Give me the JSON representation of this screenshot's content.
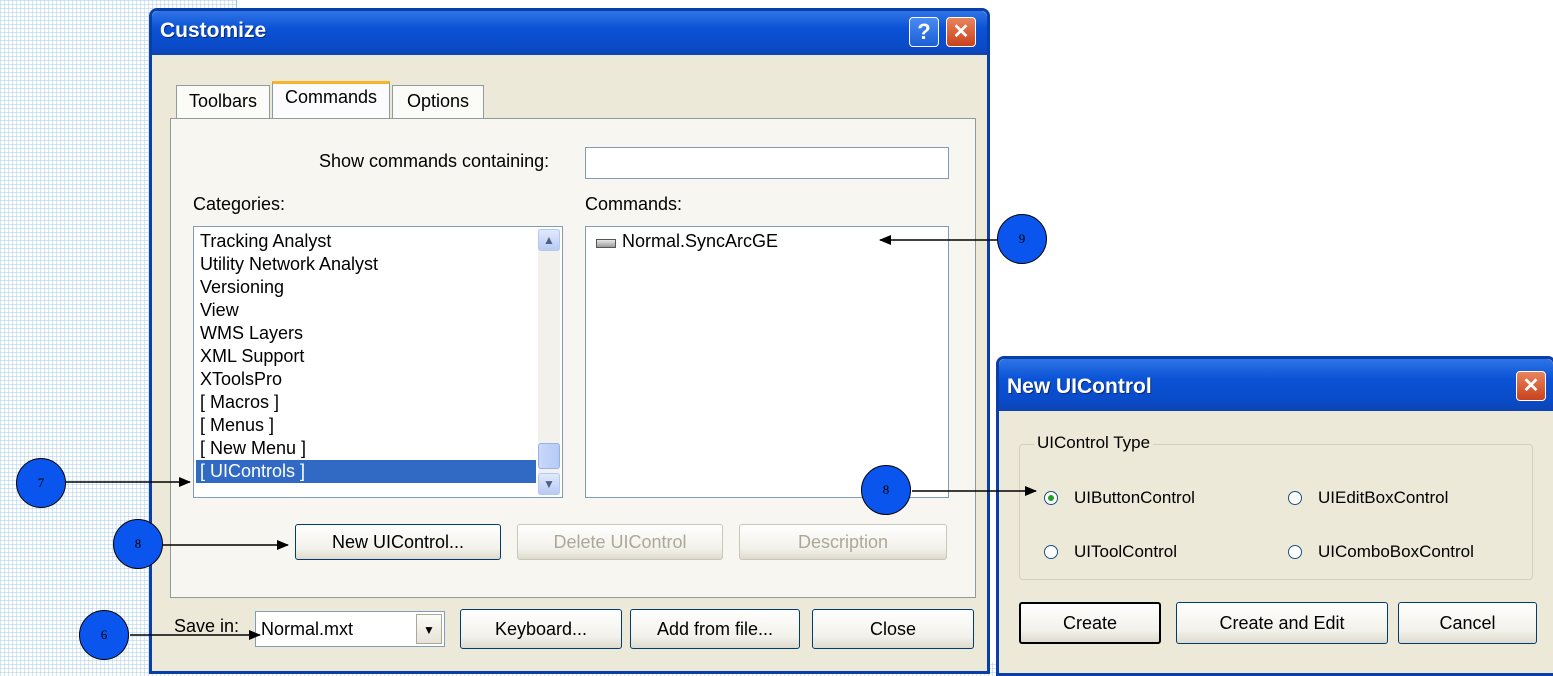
{
  "customize": {
    "title": "Customize",
    "help_glyph": "?",
    "close_glyph": "✕",
    "tabs": [
      {
        "label": "Toolbars",
        "active": false
      },
      {
        "label": "Commands",
        "active": true
      },
      {
        "label": "Options",
        "active": false
      }
    ],
    "show_label": "Show commands containing:",
    "show_value": "",
    "categories_label": "Categories:",
    "categories": [
      "Tracking Analyst",
      "Utility Network Analyst",
      "Versioning",
      "View",
      "WMS Layers",
      "XML Support",
      "XToolsPro",
      "[ Macros ]",
      "[ Menus ]",
      "[ New Menu ]",
      "[ UIControls ]"
    ],
    "selected_category": "[ UIControls ]",
    "commands_label": "Commands:",
    "commands": [
      "Normal.SyncArcGE"
    ],
    "new_btn": "New UIControl...",
    "delete_btn": "Delete UIControl",
    "description_btn": "Description",
    "save_label": "Save in:",
    "save_value": "Normal.mxt",
    "keyboard_btn": "Keyboard...",
    "add_btn": "Add from file...",
    "close_btn": "Close"
  },
  "new_uicontrol": {
    "title": "New UIControl",
    "close_glyph": "✕",
    "group_label": "UIControl Type",
    "options": [
      {
        "label": "UIButtonControl",
        "selected": true
      },
      {
        "label": "UIEditBoxControl",
        "selected": false
      },
      {
        "label": "UIToolControl",
        "selected": false
      },
      {
        "label": "UIComboBoxControl",
        "selected": false
      }
    ],
    "create_btn": "Create",
    "create_edit_btn": "Create and Edit",
    "cancel_btn": "Cancel"
  },
  "annotations": {
    "callouts": [
      "6",
      "7",
      "8",
      "8",
      "9"
    ]
  },
  "colors": {
    "title_blue": "#0a52d6",
    "dialog_face": "#ece9d8",
    "selection": "#316ac5",
    "callout_blue": "#0a55ee"
  }
}
